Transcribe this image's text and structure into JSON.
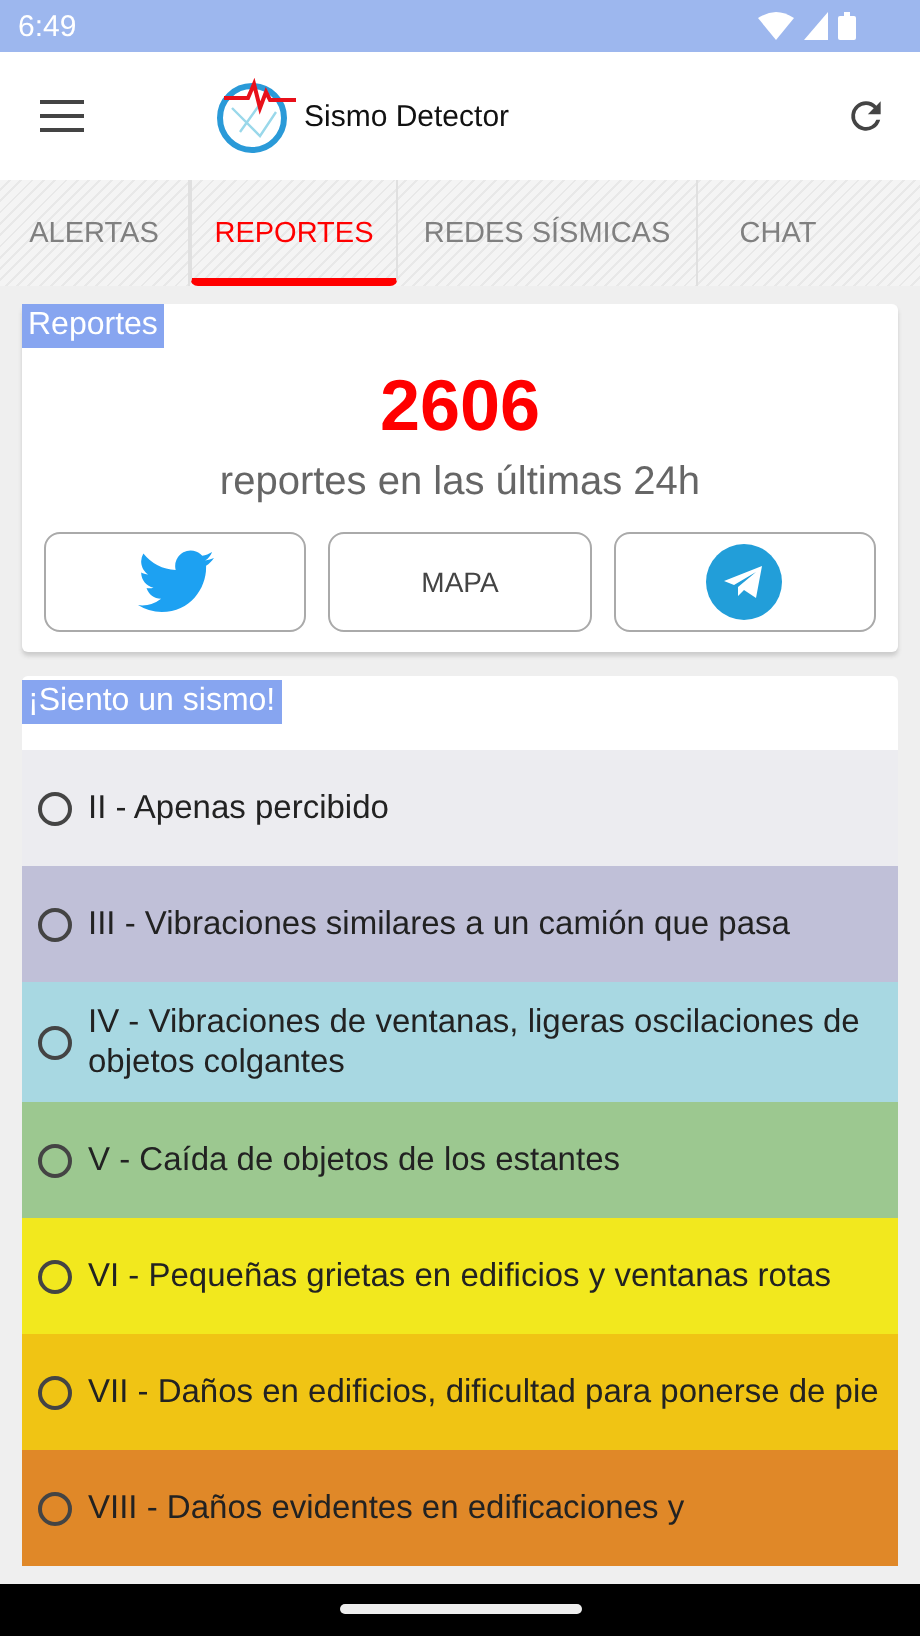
{
  "status_bar": {
    "time": "6:49"
  },
  "app_bar": {
    "title": "Sismo Detector"
  },
  "tabs": [
    {
      "label": "ALERTAS",
      "selected": false
    },
    {
      "label": "REPORTES",
      "selected": true
    },
    {
      "label": "REDES SÍSMICAS",
      "selected": false
    },
    {
      "label": "CHAT",
      "selected": false
    }
  ],
  "reports_card": {
    "heading": "Reportes",
    "count": "2606",
    "caption": "reportes en las últimas 24h",
    "map_button": "MAPA"
  },
  "feel_card": {
    "heading": "¡Siento un sismo!",
    "options": [
      {
        "label": "II - Apenas percibido",
        "selected": false,
        "color": "#ececf0"
      },
      {
        "label": "III - Vibraciones similares a un camión que pasa",
        "selected": false,
        "color": "#c0c0d8"
      },
      {
        "label": "IV - Vibraciones de ventanas, ligeras oscilaciones de objetos colgantes",
        "selected": false,
        "color": "#a8d8e2"
      },
      {
        "label": "V - Caída de objetos de los estantes",
        "selected": false,
        "color": "#9cc890"
      },
      {
        "label": "VI - Pequeñas grietas en edificios y ventanas rotas",
        "selected": false,
        "color": "#f2e81e"
      },
      {
        "label": "VII - Daños en edificios, dificultad para ponerse de pie",
        "selected": false,
        "color": "#f0c414"
      },
      {
        "label": "VIII - Daños evidentes en edificaciones y",
        "selected": false,
        "color": "#e08828"
      }
    ]
  }
}
